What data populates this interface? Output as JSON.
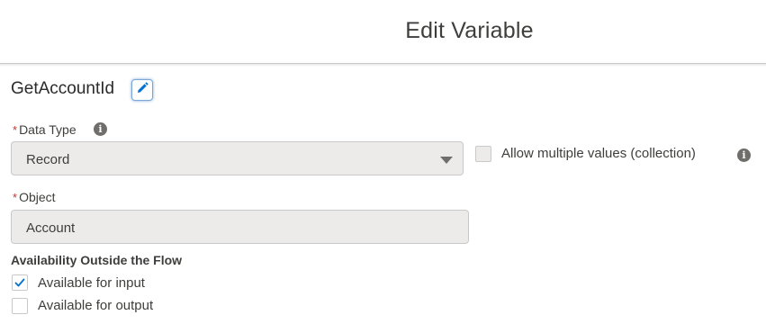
{
  "header": {
    "title": "Edit Variable"
  },
  "variable": {
    "api_name": "GetAccountId",
    "edit_icon": "pencil-icon"
  },
  "data_type": {
    "required_marker": "*",
    "label": "Data Type",
    "info_icon": "info-icon",
    "value": "Record",
    "allow_multiple": {
      "label": "Allow multiple values (collection)",
      "checked": false
    }
  },
  "object": {
    "required_marker": "*",
    "label": "Object",
    "value": "Account"
  },
  "availability": {
    "title": "Availability Outside the Flow",
    "options": [
      {
        "label": "Available for input",
        "checked": true
      },
      {
        "label": "Available for output",
        "checked": false
      }
    ]
  },
  "colors": {
    "required": "#c23934",
    "focus_ring": "#7aa7d8",
    "check": "#0070d2"
  }
}
